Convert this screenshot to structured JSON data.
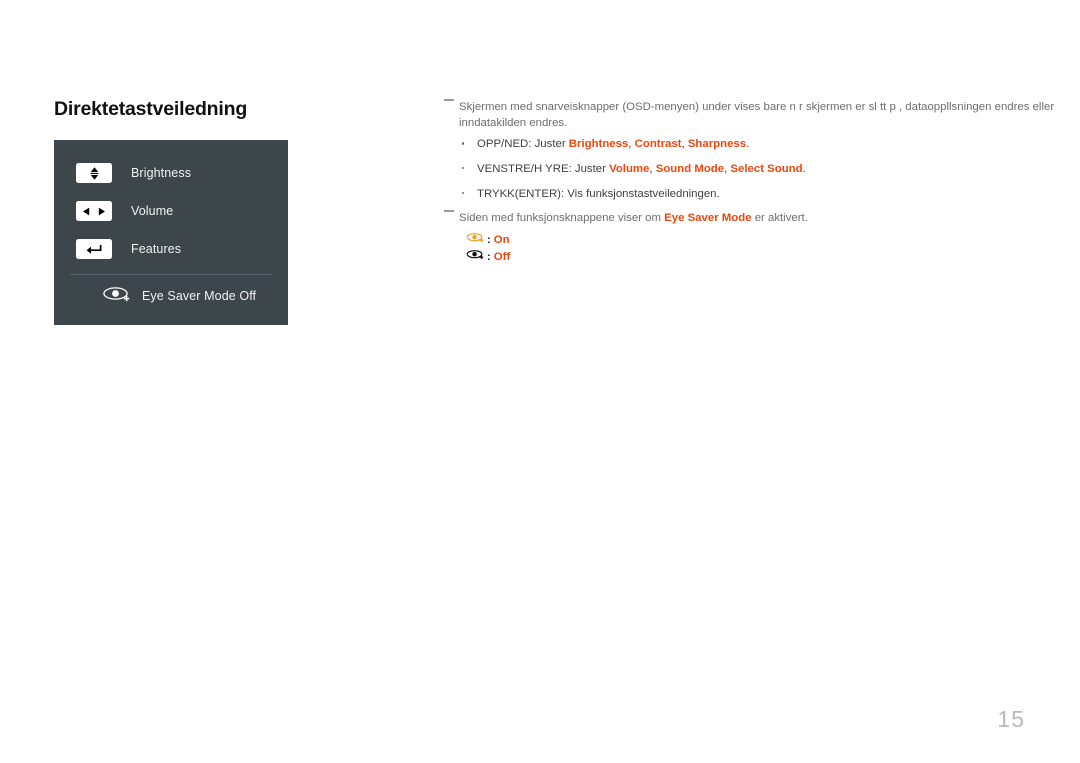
{
  "document": {
    "title": "Direktetastveiledning",
    "page_number": "15"
  },
  "osd_panel": {
    "rows": [
      {
        "icon": "up-down-arrows-icon",
        "label": "Brightness"
      },
      {
        "icon": "left-right-arrows-icon",
        "label": "Volume"
      },
      {
        "icon": "enter-return-arrow-icon",
        "label": "Features"
      }
    ],
    "eye_saver": {
      "icon": "eye-saver-off-icon",
      "label": "Eye Saver Mode Off"
    },
    "colors": {
      "panel_background": "#3c464b",
      "key_background": "#ffffff",
      "label_text": "#f2f2f2",
      "divider": "#59636a"
    }
  },
  "notes": {
    "note1": {
      "marker": "em-dash-marker",
      "text": "Skjermen med snarveisknapper (OSD-menyen) under vises bare n r skjermen er sl tt p , dataoppllsningen endres eller inndatakilden endres."
    },
    "bullets": [
      {
        "marker": "bullet-dot",
        "prefix": "OPP/NED: Juster ",
        "terms": [
          "Brightness",
          "Contrast",
          "Sharpness"
        ],
        "separator": ", ",
        "suffix": "."
      },
      {
        "marker": "bullet-dot",
        "prefix": "VENSTRE/H YRE: Juster ",
        "terms": [
          "Volume",
          "Sound Mode",
          "Select Sound"
        ],
        "separator": ", ",
        "suffix": "."
      },
      {
        "marker": "bullet-dot",
        "prefix": "TRYKK(ENTER): Vis funksjonstastveiledningen.",
        "terms": [],
        "separator": "",
        "suffix": ""
      }
    ],
    "note2": {
      "marker": "em-dash-marker",
      "prefix": "Siden med funksjonsknappene viser om ",
      "term": "Eye Saver Mode",
      "suffix": " er aktivert."
    }
  },
  "eye_legend": [
    {
      "icon": "eye-saver-on-icon",
      "separator": ":",
      "state": "On",
      "icon_color": "#f0a22e"
    },
    {
      "icon": "eye-saver-off-icon",
      "separator": ":",
      "state": "Off",
      "icon_color": "#111111"
    }
  ],
  "colors": {
    "accent_orange": "#e8490f",
    "body_text": "#6d6d6d",
    "bullet_text": "#3f3f3f",
    "page_number": "#b9b9b9"
  }
}
